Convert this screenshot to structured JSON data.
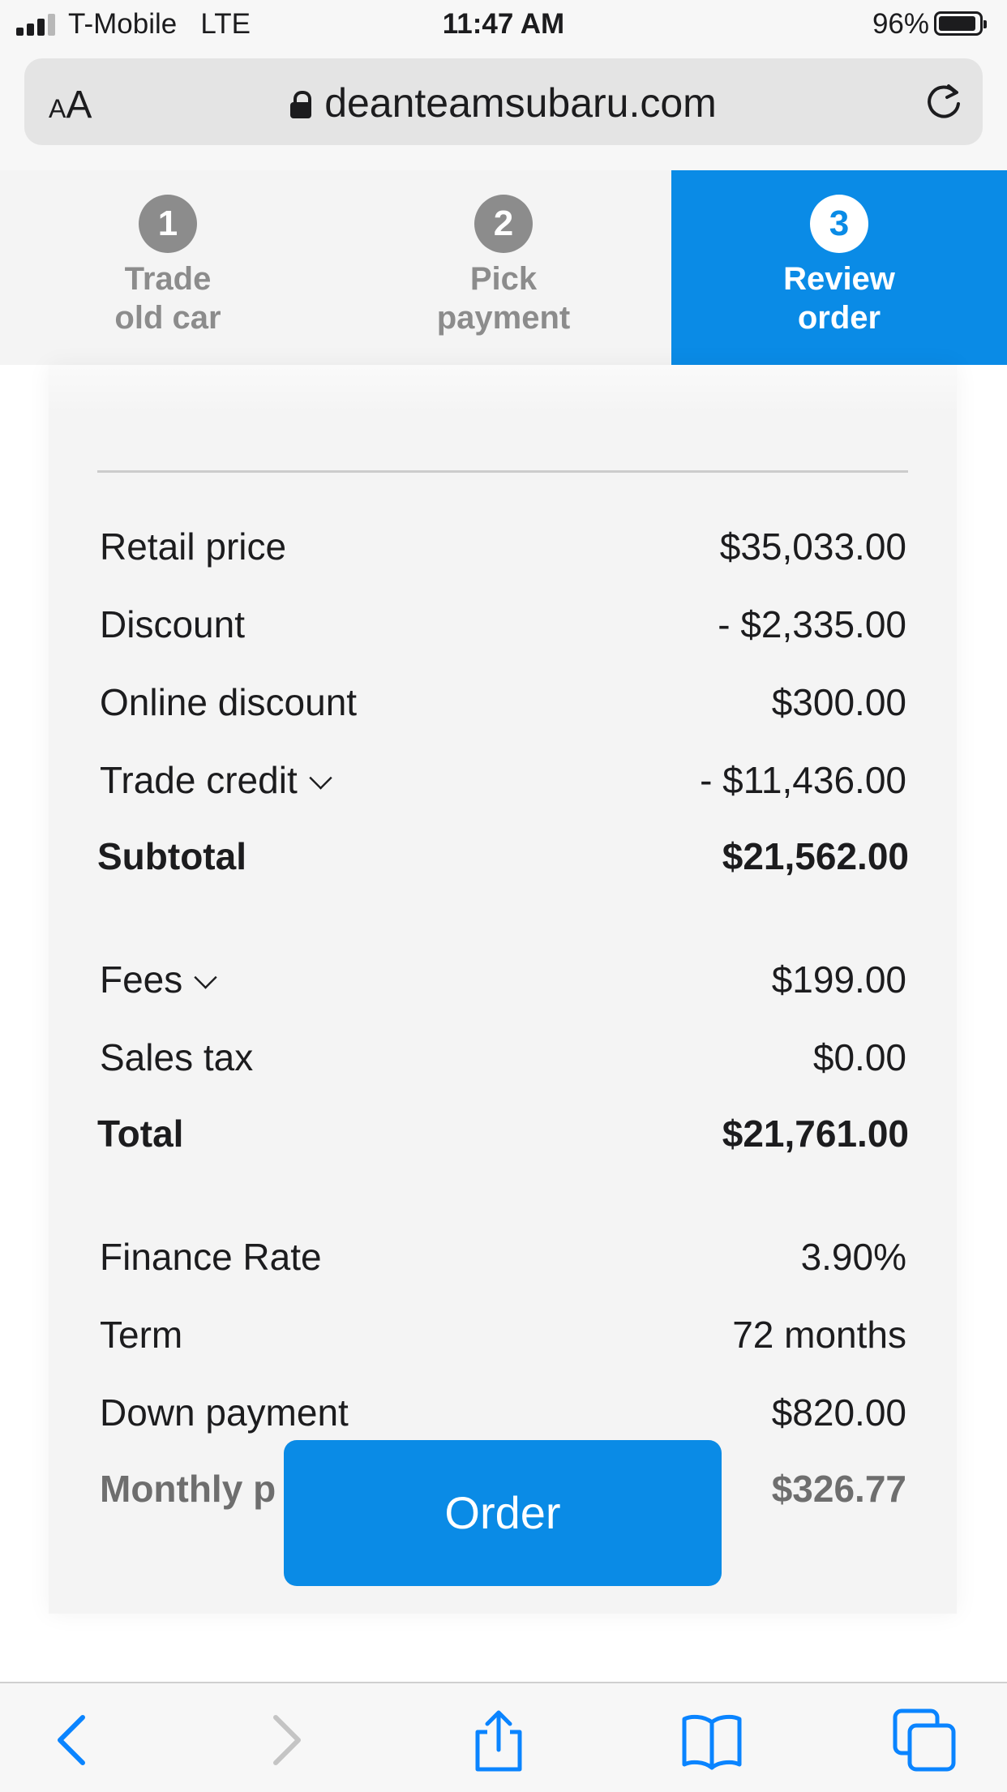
{
  "status_bar": {
    "carrier": "T-Mobile",
    "network": "LTE",
    "time": "11:47 AM",
    "battery": "96%",
    "battery_level": 0.96
  },
  "browser": {
    "text_size_label_small": "A",
    "text_size_label_large": "A",
    "url": "deanteamsubaru.com"
  },
  "steps": [
    {
      "number": "1",
      "line1": "Trade",
      "line2": "old car",
      "active": false
    },
    {
      "number": "2",
      "line1": "Pick",
      "line2": "payment",
      "active": false
    },
    {
      "number": "3",
      "line1": "Review",
      "line2": "order",
      "active": true
    }
  ],
  "summary": {
    "retail_price": {
      "label": "Retail price",
      "value": "$35,033.00"
    },
    "discount": {
      "label": "Discount",
      "value": "- $2,335.00"
    },
    "online_discount": {
      "label": "Online discount",
      "value": "$300.00"
    },
    "trade_credit": {
      "label": "Trade credit",
      "value": "- $11,436.00"
    },
    "subtotal": {
      "label": "Subtotal",
      "value": "$21,562.00"
    },
    "fees": {
      "label": "Fees",
      "value": "$199.00"
    },
    "sales_tax": {
      "label": "Sales tax",
      "value": "$0.00"
    },
    "total": {
      "label": "Total",
      "value": "$21,761.00"
    },
    "finance_rate": {
      "label": "Finance Rate",
      "value": "3.90%"
    },
    "term": {
      "label": "Term",
      "value": "72 months"
    },
    "down_payment": {
      "label": "Down payment",
      "value": "$820.00"
    },
    "monthly_payment": {
      "label": "Monthly p",
      "value": "$326.77"
    }
  },
  "order_button": "Order",
  "colors": {
    "accent": "#0a8be6",
    "inactive_step": "#8c8c8c",
    "card_bg": "#f4f4f4"
  },
  "icons": [
    "lock-icon",
    "reload-icon",
    "back-icon",
    "forward-icon",
    "share-icon",
    "bookmarks-icon",
    "tabs-icon"
  ]
}
